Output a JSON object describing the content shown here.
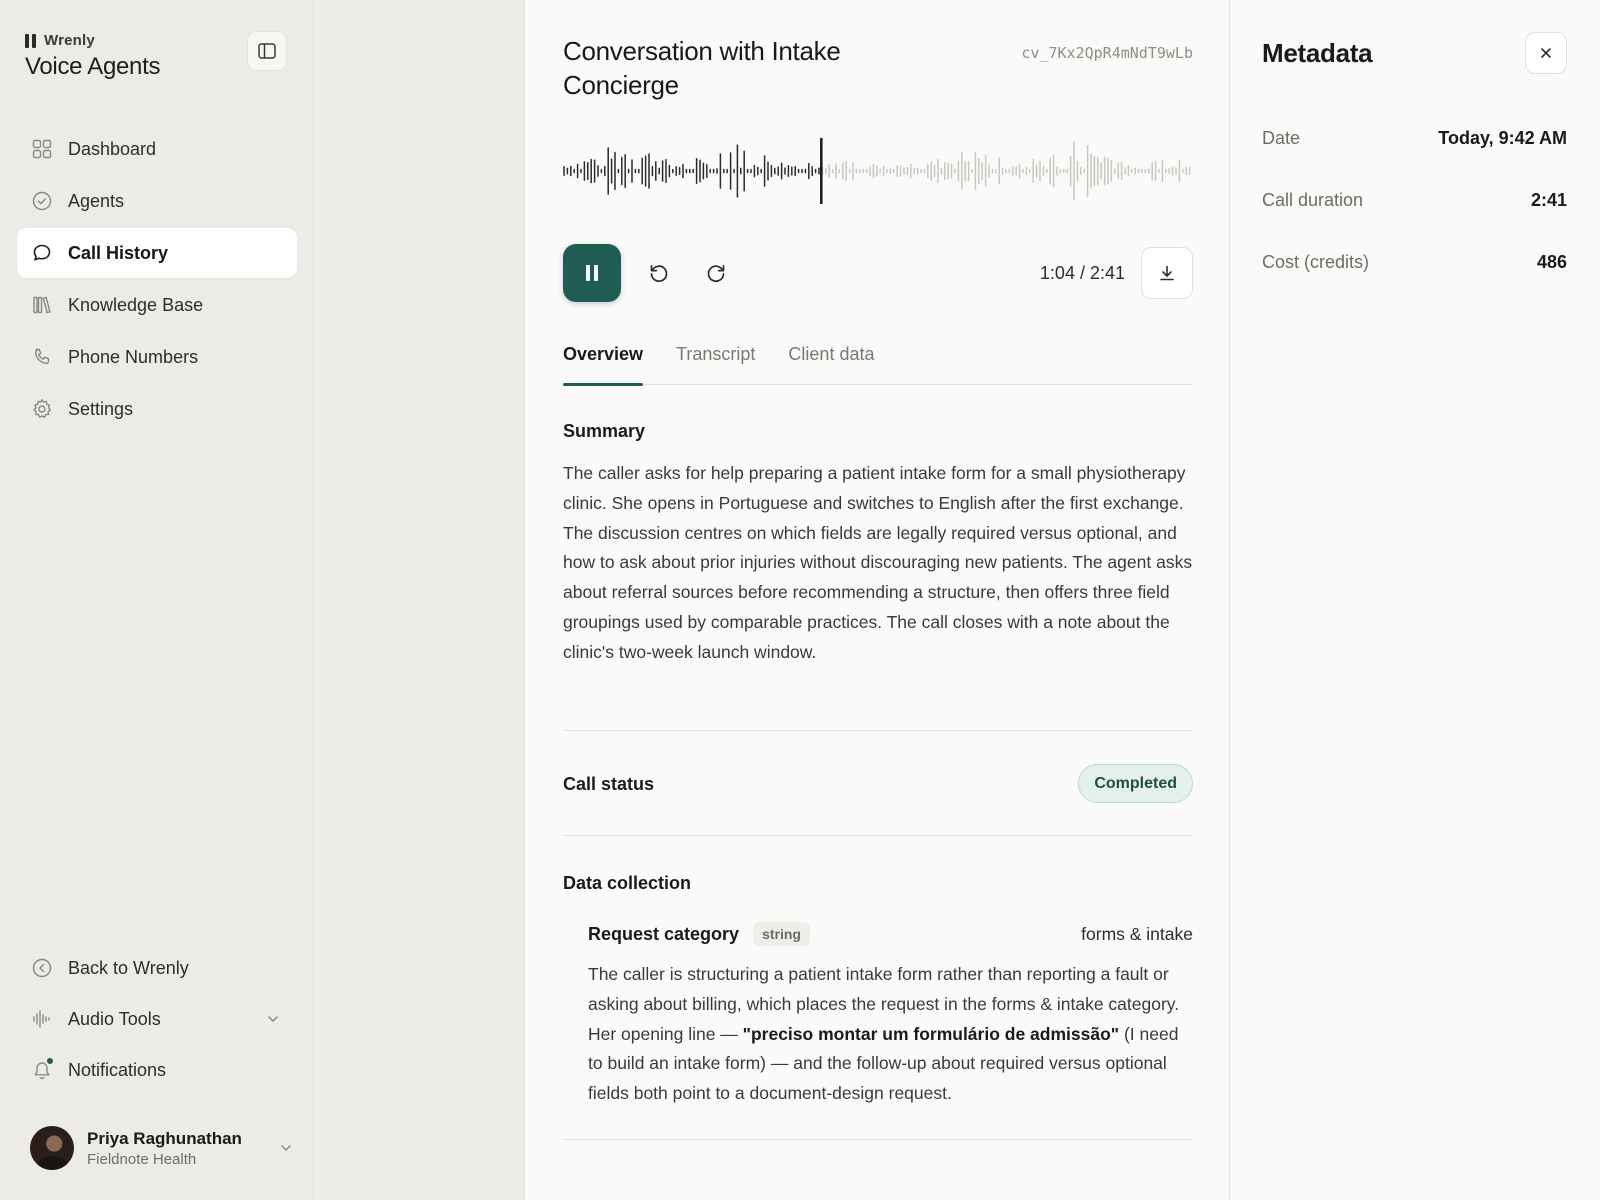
{
  "brand": {
    "small": "Wrenly",
    "title": "Voice Agents"
  },
  "sidebar": {
    "items": [
      {
        "label": "Dashboard",
        "icon": "grid-icon"
      },
      {
        "label": "Agents",
        "icon": "check-circle-icon"
      },
      {
        "label": "Call History",
        "icon": "chat-bubble-icon",
        "active": true
      },
      {
        "label": "Knowledge Base",
        "icon": "books-icon"
      },
      {
        "label": "Phone Numbers",
        "icon": "phone-icon"
      },
      {
        "label": "Settings",
        "icon": "gear-icon"
      }
    ],
    "bottom": [
      {
        "label": "Back to Wrenly",
        "icon": "circle-chevron-left-icon"
      },
      {
        "label": "Audio Tools",
        "icon": "audio-wave-icon"
      },
      {
        "label": "Notifications",
        "icon": "bell-icon"
      }
    ]
  },
  "user": {
    "name": "Priya Raghunathan",
    "org": "Fieldnote Health"
  },
  "conversation": {
    "title": "Conversation with Intake Concierge",
    "id": "cv_7Kx2QpR4mNdT9wLb",
    "progress_fraction": 0.41
  },
  "player": {
    "time": "1:04 / 2:41"
  },
  "tabs": [
    {
      "label": "Overview",
      "active": true
    },
    {
      "label": "Transcript"
    },
    {
      "label": "Client data"
    }
  ],
  "summary": {
    "heading": "Summary",
    "text": "The caller asks for help preparing a patient intake form for a small physiotherapy clinic. She opens in Portuguese and switches to English after the first exchange. The discussion centres on which fields are legally required versus optional, and how to ask about prior injuries without discouraging new patients. The agent asks about referral sources before recommending a structure, then offers three field groupings used by comparable practices. The call closes with a note about the clinic's two-week launch window."
  },
  "status": {
    "label": "Call status",
    "value": "Completed"
  },
  "data_collection": {
    "heading": "Data collection",
    "field_name": "Request category",
    "field_type": "string",
    "field_value": "forms & intake",
    "desc_before": "The caller is structuring a patient intake form rather than reporting a fault or asking about billing, which places the request in the forms & intake category. Her opening line — ",
    "desc_quote": "\"preciso montar um formulário de admissão\"",
    "desc_after": " (I need to build an intake form) — and the follow-up about required versus optional fields both point to a document-design request."
  },
  "metadata": {
    "title": "Metadata",
    "rows": [
      {
        "key": "Date",
        "value": "Today, 9:42 AM"
      },
      {
        "key": "Call duration",
        "value": "2:41"
      },
      {
        "key": "Cost (credits)",
        "value": "486"
      }
    ]
  },
  "colors": {
    "accent": "#1f5d53",
    "badge_bg": "#e3f0ec"
  }
}
